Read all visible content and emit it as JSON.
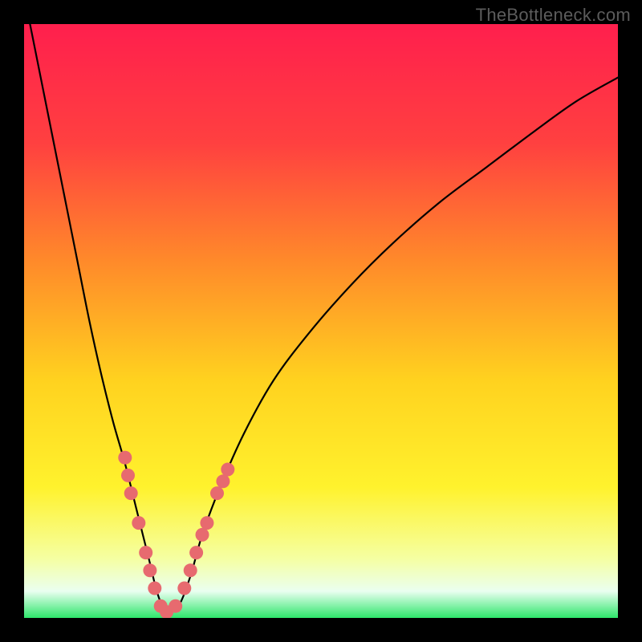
{
  "watermark": "TheBottleneck.com",
  "colors": {
    "frame": "#000000",
    "gradient_stops": [
      {
        "pos": 0.0,
        "color": "#ff1f4d"
      },
      {
        "pos": 0.2,
        "color": "#ff4040"
      },
      {
        "pos": 0.4,
        "color": "#ff8a2a"
      },
      {
        "pos": 0.6,
        "color": "#ffd21f"
      },
      {
        "pos": 0.78,
        "color": "#fff22d"
      },
      {
        "pos": 0.9,
        "color": "#f5ffa2"
      },
      {
        "pos": 0.955,
        "color": "#eafff0"
      },
      {
        "pos": 1.0,
        "color": "#2ee66b"
      }
    ],
    "curve": "#000000",
    "marker": "#e76a6f",
    "marker_stroke": "#c94a50"
  },
  "chart_data": {
    "type": "line",
    "title": "",
    "xlabel": "",
    "ylabel": "",
    "xlim": [
      0,
      100
    ],
    "ylim": [
      0,
      100
    ],
    "grid": false,
    "legend": false,
    "annotations": [
      "TheBottleneck.com"
    ],
    "series": [
      {
        "name": "curve",
        "x": [
          1,
          3,
          5,
          7,
          9,
          11,
          13,
          15,
          17,
          19,
          21,
          22.5,
          24,
          26,
          28,
          30,
          33,
          37,
          42,
          48,
          55,
          62,
          70,
          78,
          86,
          93,
          100
        ],
        "y": [
          100,
          90,
          80,
          70,
          60,
          50,
          41,
          33,
          26,
          18,
          10,
          4,
          1,
          2,
          7,
          14,
          22,
          31,
          40,
          48,
          56,
          63,
          70,
          76,
          82,
          87,
          91
        ]
      }
    ],
    "markers": [
      {
        "x": 17.0,
        "y": 27
      },
      {
        "x": 17.5,
        "y": 24
      },
      {
        "x": 18.0,
        "y": 21
      },
      {
        "x": 19.3,
        "y": 16
      },
      {
        "x": 20.5,
        "y": 11
      },
      {
        "x": 21.2,
        "y": 8
      },
      {
        "x": 22.0,
        "y": 5
      },
      {
        "x": 23.0,
        "y": 2
      },
      {
        "x": 24.0,
        "y": 1
      },
      {
        "x": 25.5,
        "y": 2
      },
      {
        "x": 27.0,
        "y": 5
      },
      {
        "x": 28.0,
        "y": 8
      },
      {
        "x": 29.0,
        "y": 11
      },
      {
        "x": 30.0,
        "y": 14
      },
      {
        "x": 30.8,
        "y": 16
      },
      {
        "x": 32.5,
        "y": 21
      },
      {
        "x": 33.5,
        "y": 23
      },
      {
        "x": 34.3,
        "y": 25
      }
    ]
  }
}
